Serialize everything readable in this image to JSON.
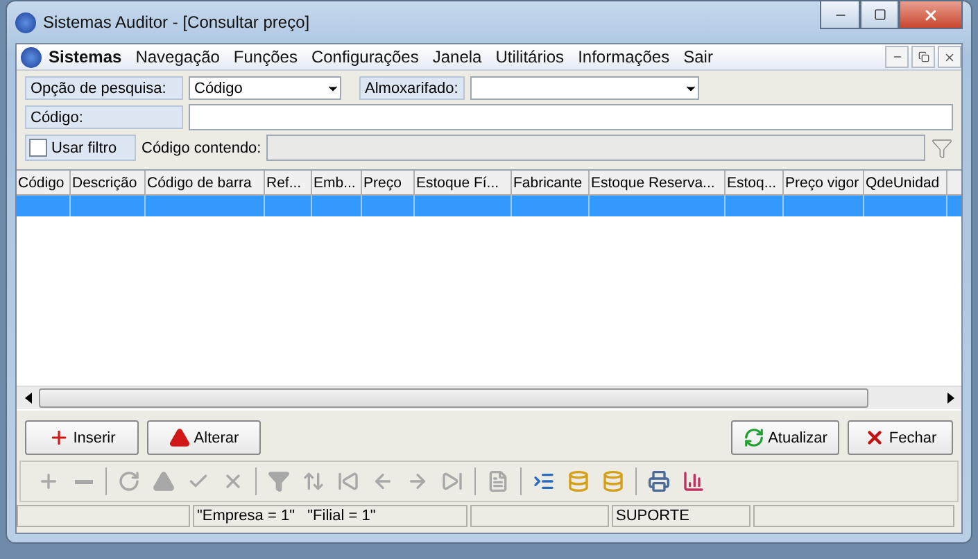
{
  "window": {
    "title": "Sistemas Auditor - [Consultar preço]"
  },
  "menu": [
    {
      "label": "Sistemas",
      "bold": true
    },
    {
      "label": "Navegação",
      "bold": false
    },
    {
      "label": "Funções",
      "bold": false
    },
    {
      "label": "Configurações",
      "bold": false
    },
    {
      "label": "Janela",
      "bold": false
    },
    {
      "label": "Utilitários",
      "bold": false
    },
    {
      "label": "Informações",
      "bold": false
    },
    {
      "label": "Sair",
      "bold": false
    }
  ],
  "search": {
    "option_label": "Opção de pesquisa:",
    "option_value": "Código",
    "warehouse_label": "Almoxarifado:",
    "code_label": "Código:",
    "use_filter": {
      "label": "Usar filtro",
      "checked": false
    },
    "contains_label": "Código contendo:"
  },
  "table": {
    "columns": [
      {
        "label": "Código"
      },
      {
        "label": "Descrição"
      },
      {
        "label": "Código de barra"
      },
      {
        "label": "Ref..."
      },
      {
        "label": "Emb..."
      },
      {
        "label": "Preço"
      },
      {
        "label": "Estoque Fí..."
      },
      {
        "label": "Fabricante"
      },
      {
        "label": "Estoque Reserva..."
      },
      {
        "label": "Estoq..."
      },
      {
        "label": "Preço vigor"
      },
      {
        "label": "QdeUnidad"
      }
    ],
    "rows": [
      {
        "selected": true
      }
    ]
  },
  "buttons_left": [
    {
      "label": "Inserir",
      "kind": "insert"
    },
    {
      "label": "Alterar",
      "kind": "edit"
    }
  ],
  "buttons_right": [
    {
      "label": "Atualizar",
      "kind": "refresh"
    },
    {
      "label": "Fechar",
      "kind": "close"
    }
  ],
  "toolbar": [
    {
      "kind": "plus",
      "disabled": true
    },
    {
      "kind": "minus",
      "disabled": true
    },
    {
      "kind": "sep"
    },
    {
      "kind": "undo",
      "disabled": true
    },
    {
      "kind": "up",
      "disabled": true
    },
    {
      "kind": "check",
      "disabled": true
    },
    {
      "kind": "cancel",
      "disabled": true
    },
    {
      "kind": "sep"
    },
    {
      "kind": "funnel",
      "disabled": true
    },
    {
      "kind": "sort",
      "disabled": true
    },
    {
      "kind": "first",
      "disabled": true
    },
    {
      "kind": "prev",
      "disabled": true
    },
    {
      "kind": "next",
      "disabled": true
    },
    {
      "kind": "last",
      "disabled": true
    },
    {
      "kind": "sep"
    },
    {
      "kind": "doc",
      "disabled": true
    },
    {
      "kind": "sep"
    },
    {
      "kind": "list",
      "disabled": false
    },
    {
      "kind": "transfer",
      "disabled": false
    },
    {
      "kind": "dblist",
      "disabled": false
    },
    {
      "kind": "sep"
    },
    {
      "kind": "print",
      "disabled": false
    },
    {
      "kind": "chart",
      "disabled": false
    }
  ],
  "status_bar": {
    "company": "\"Empresa = 1\"   \"Filial = 1\"",
    "user": "SUPORTE"
  }
}
